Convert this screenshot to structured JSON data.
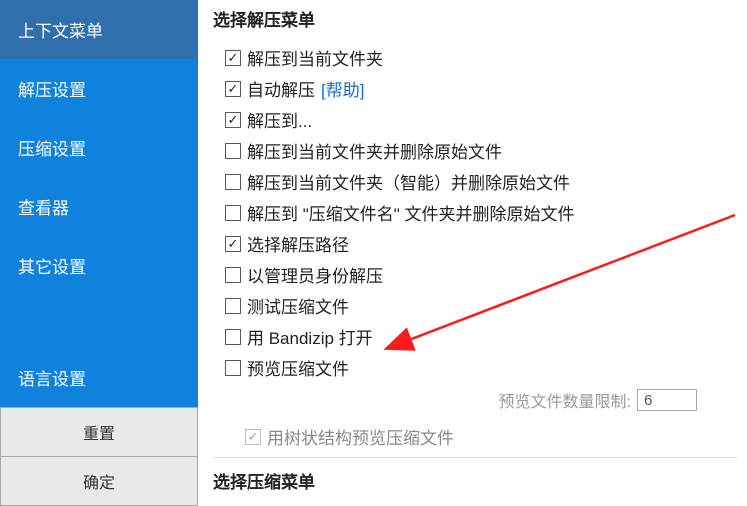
{
  "sidebar": {
    "items": [
      {
        "label": "上下文菜单",
        "active": true
      },
      {
        "label": "解压设置",
        "active": false
      },
      {
        "label": "压缩设置",
        "active": false
      },
      {
        "label": "查看器",
        "active": false
      },
      {
        "label": "其它设置",
        "active": false
      }
    ],
    "language_label": "语言设置",
    "reset_label": "重置",
    "ok_label": "确定"
  },
  "main": {
    "extract_menu_title": "选择解压菜单",
    "compress_menu_title": "选择压缩菜单",
    "help_label": "[帮助]",
    "preview_limit_label": "预览文件数量限制:",
    "preview_limit_value": "6",
    "items": [
      {
        "label": "解压到当前文件夹",
        "checked": true
      },
      {
        "label": "自动解压",
        "checked": true,
        "help": true
      },
      {
        "label": "解压到...",
        "checked": true
      },
      {
        "label": "解压到当前文件夹并删除原始文件",
        "checked": false
      },
      {
        "label": "解压到当前文件夹（智能）并删除原始文件",
        "checked": false
      },
      {
        "label": "解压到 \"压缩文件名\" 文件夹并删除原始文件",
        "checked": false
      },
      {
        "label": "选择解压路径",
        "checked": true
      },
      {
        "label": "以管理员身份解压",
        "checked": false
      },
      {
        "label": "测试压缩文件",
        "checked": false
      },
      {
        "label": "用 Bandizip 打开",
        "checked": false
      },
      {
        "label": "预览压缩文件",
        "checked": false
      }
    ],
    "tree_preview_label": "用树状结构预览压缩文件",
    "tree_preview_checked": true
  }
}
